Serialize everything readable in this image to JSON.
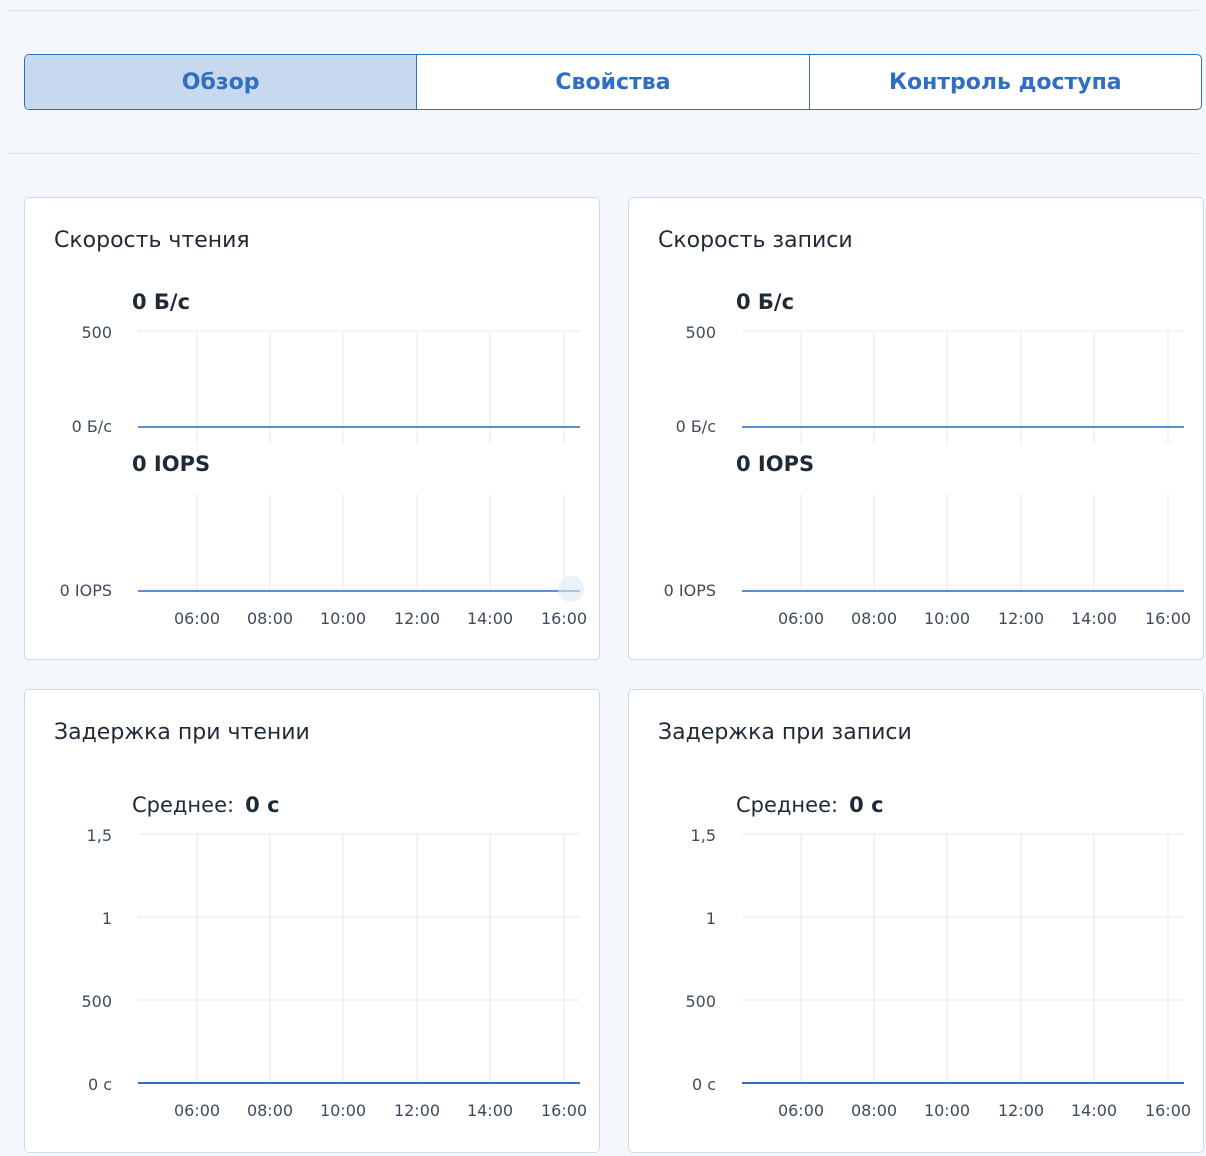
{
  "tabs": [
    {
      "label": "Обзор",
      "active": true
    },
    {
      "label": "Свойства",
      "active": false
    },
    {
      "label": "Контроль доступа",
      "active": false
    }
  ],
  "x_ticks": [
    "06:00",
    "08:00",
    "10:00",
    "12:00",
    "14:00",
    "16:00"
  ],
  "cards": {
    "read_speed": {
      "title": "Скорость чтения",
      "throughput": {
        "value": "0 Б/с",
        "ticks": [
          "500",
          "0 Б/с"
        ]
      },
      "iops": {
        "value": "0 IOPS",
        "ticks": [
          "0 IOPS"
        ]
      }
    },
    "write_speed": {
      "title": "Скорость записи",
      "throughput": {
        "value": "0 Б/с",
        "ticks": [
          "500",
          "0 Б/с"
        ]
      },
      "iops": {
        "value": "0 IOPS",
        "ticks": [
          "0 IOPS"
        ]
      }
    },
    "read_latency": {
      "title": "Задержка при чтении",
      "avg_label": "Среднее:",
      "avg_value": "0 с",
      "ticks": [
        "1,5",
        "1",
        "500",
        "0 с"
      ]
    },
    "write_latency": {
      "title": "Задержка при записи",
      "avg_label": "Среднее:",
      "avg_value": "0 с",
      "ticks": [
        "1,5",
        "1",
        "500",
        "0 с"
      ]
    }
  },
  "chart_data": [
    {
      "type": "line",
      "title": "Скорость чтения",
      "x": [
        "06:00",
        "08:00",
        "10:00",
        "12:00",
        "14:00",
        "16:00"
      ],
      "series": [
        {
          "values": [
            0,
            0,
            0,
            0,
            0,
            0
          ]
        }
      ]
    },
    {
      "type": "line",
      "title": "Скорость записи",
      "x": [
        "06:00",
        "08:00",
        "10:00",
        "12:00",
        "14:00",
        "16:00"
      ],
      "series": [
        {
          "values": [
            0,
            0,
            0,
            0,
            0,
            0
          ]
        }
      ]
    },
    {
      "type": "line",
      "title": "Задержка при чтении",
      "x": [
        "06:00",
        "08:00",
        "10:00",
        "12:00",
        "14:00",
        "16:00"
      ],
      "series": [
        {
          "values": [
            0,
            0,
            0,
            0,
            0,
            0
          ]
        }
      ]
    },
    {
      "type": "line",
      "title": "Задержка при записи",
      "x": [
        "06:00",
        "08:00",
        "10:00",
        "12:00",
        "14:00",
        "16:00"
      ],
      "series": [
        {
          "values": [
            0,
            0,
            0,
            0,
            0,
            0
          ]
        }
      ]
    }
  ],
  "colors": {
    "accent": "#2f6fc2",
    "active_tab_bg": "#c8d9ef",
    "line": "#5b8fd6",
    "grid": "#e4e9ef"
  }
}
